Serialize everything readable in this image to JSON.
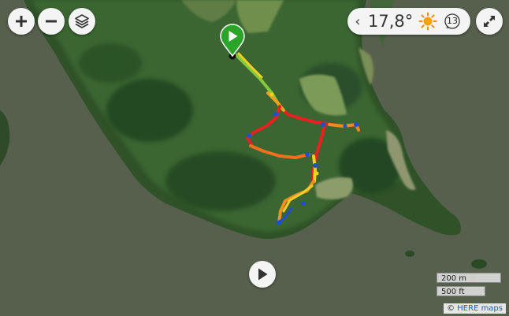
{
  "controls": {
    "zoom_in_icon": "plus-icon",
    "zoom_out_icon": "minus-icon",
    "layers_icon": "layers-icon",
    "fullscreen_icon": "expand-icon",
    "play_icon": "play-icon"
  },
  "weather": {
    "chevron": "‹",
    "temperature": "17,8°",
    "condition_icon": "sun-icon",
    "wind_speed": "13"
  },
  "scale": {
    "metric": "200 m",
    "imperial": "500 ft"
  },
  "attribution": {
    "prefix": "©",
    "provider": "HERE maps"
  },
  "colors": {
    "water": "#4f5a48",
    "forest": "#2f5a2a",
    "meadow": "#6f8f4e",
    "start_marker": "#2aa52a",
    "track_slow": "#1f4fd1",
    "track_medium": "#f0d020",
    "track_fast": "#e82020"
  }
}
